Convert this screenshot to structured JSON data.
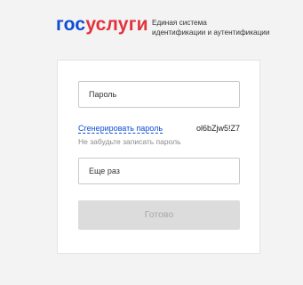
{
  "header": {
    "logo_part1": "гос",
    "logo_part2": "услуги",
    "tagline_line1": "Единая система",
    "tagline_line2": "идентификации и аутентификации"
  },
  "form": {
    "password_placeholder": "Пароль",
    "generate_link": "Сгенерировать пароль",
    "generated_password": "ol6bZjw5!Z7",
    "hint": "Не забудьте записать пароль",
    "repeat_placeholder": "Еще раз",
    "submit_label": "Готово",
    "submit_disabled": true
  },
  "colors": {
    "brand_blue": "#0d4cd3",
    "brand_red": "#e2323c",
    "background": "#f3f3f3",
    "card": "#ffffff",
    "disabled_button": "#dcdcdc"
  }
}
